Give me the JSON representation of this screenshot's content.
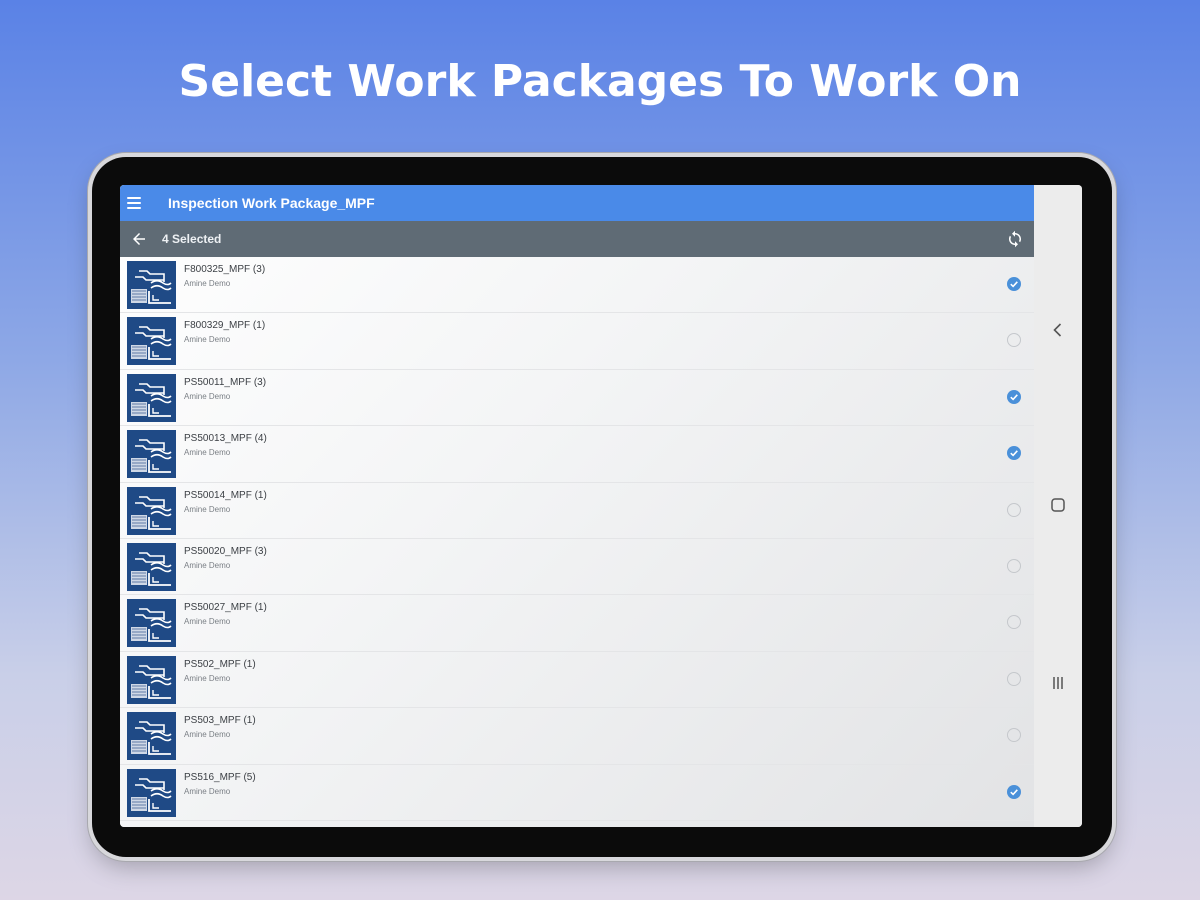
{
  "headline": "Select Work Packages To Work On",
  "app": {
    "title": "Inspection Work Package_MPF",
    "selection_label": "4 Selected"
  },
  "icons": {
    "menu": "menu-icon",
    "back": "arrow-left-icon",
    "sync": "sync-icon",
    "package": "folder-stack-icon",
    "checked": "check-circle-icon",
    "unchecked": "circle-outline-icon",
    "nav_back": "chevron-left-icon",
    "nav_home": "square-icon",
    "nav_recents": "recents-icon"
  },
  "colors": {
    "appbar": "#4a8ae8",
    "selbar": "#5f6b75",
    "thumb": "#1f4a86",
    "check": "#4a90d9"
  },
  "packages": [
    {
      "title": "F800325_MPF (3)",
      "subtitle": "Amine Demo",
      "selected": true
    },
    {
      "title": "F800329_MPF (1)",
      "subtitle": "Amine Demo",
      "selected": false
    },
    {
      "title": "PS50011_MPF (3)",
      "subtitle": "Amine Demo",
      "selected": true
    },
    {
      "title": "PS50013_MPF (4)",
      "subtitle": "Amine Demo",
      "selected": true
    },
    {
      "title": "PS50014_MPF (1)",
      "subtitle": "Amine Demo",
      "selected": false
    },
    {
      "title": "PS50020_MPF (3)",
      "subtitle": "Amine Demo",
      "selected": false
    },
    {
      "title": "PS50027_MPF (1)",
      "subtitle": "Amine Demo",
      "selected": false
    },
    {
      "title": "PS502_MPF (1)",
      "subtitle": "Amine Demo",
      "selected": false
    },
    {
      "title": "PS503_MPF (1)",
      "subtitle": "Amine Demo",
      "selected": false
    },
    {
      "title": "PS516_MPF (5)",
      "subtitle": "Amine Demo",
      "selected": true
    }
  ]
}
